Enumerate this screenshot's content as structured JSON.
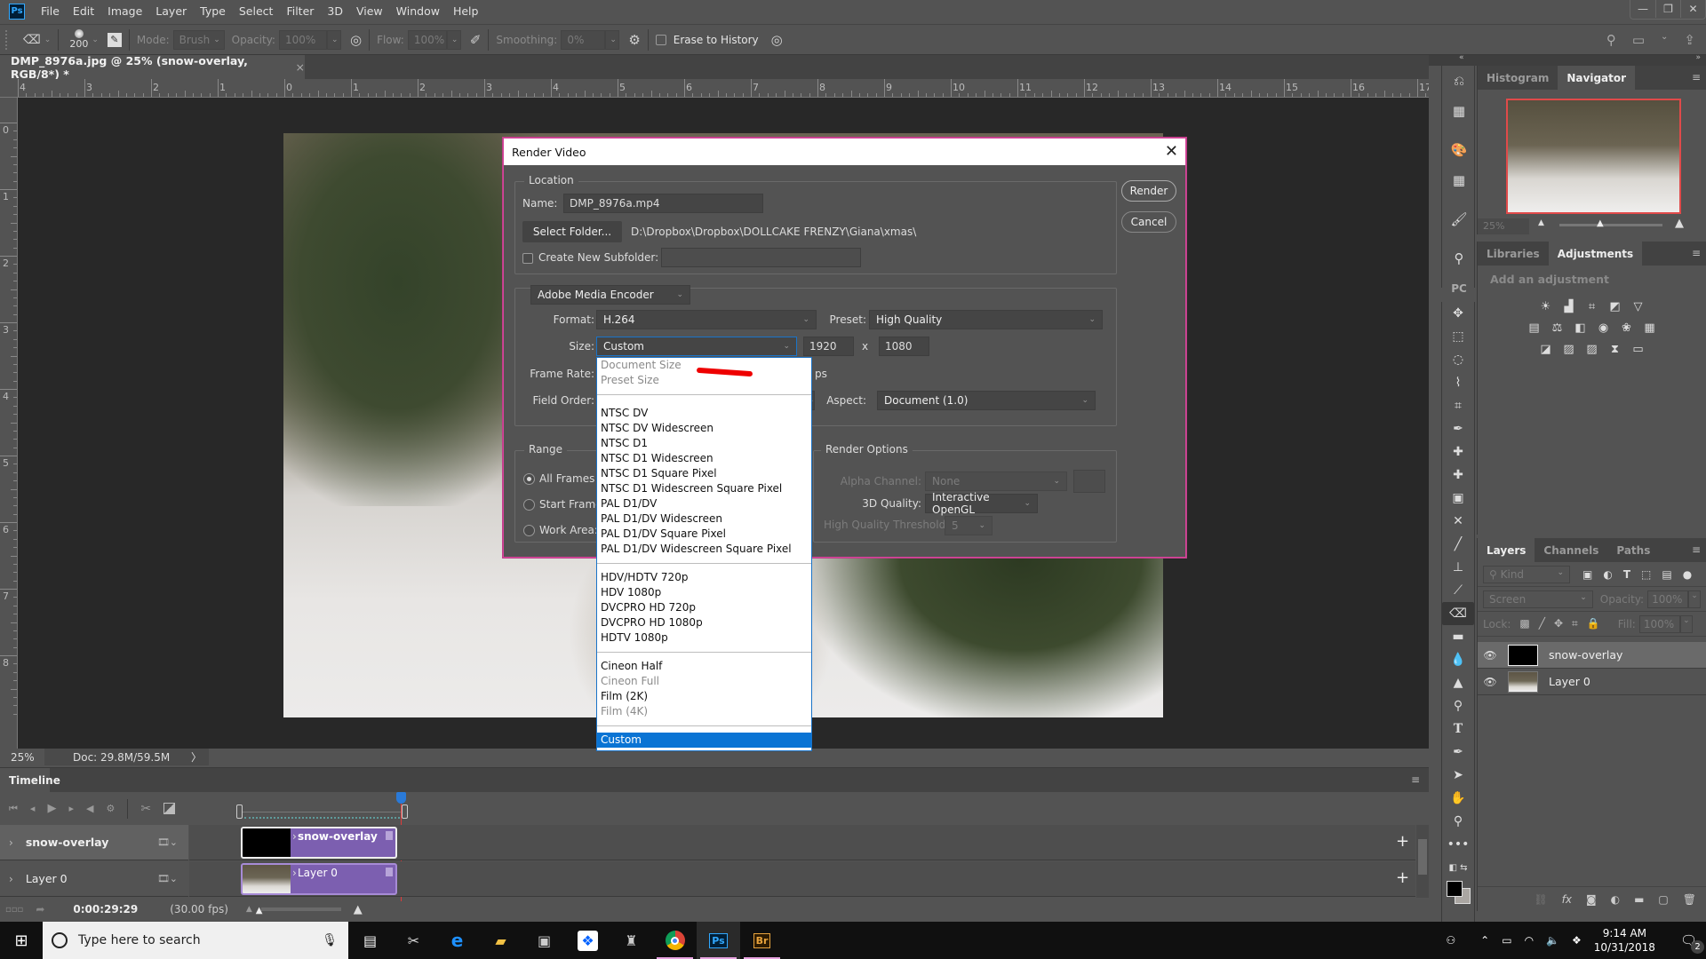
{
  "app": {
    "logo": "Ps"
  },
  "menu": [
    "File",
    "Edit",
    "Image",
    "Layer",
    "Type",
    "Select",
    "Filter",
    "3D",
    "View",
    "Window",
    "Help"
  ],
  "window_controls": {
    "minimize": "—",
    "restore": "❐",
    "close": "✕"
  },
  "options_bar": {
    "brush_size": "200",
    "mode_label": "Mode:",
    "mode_value": "Brush",
    "opacity_label": "Opacity:",
    "opacity_value": "100%",
    "flow_label": "Flow:",
    "flow_value": "100%",
    "smoothing_label": "Smoothing:",
    "smoothing_value": "0%",
    "erase_history_label": "Erase to History",
    "erase_history_checked": false
  },
  "document": {
    "tab_title": "DMP_8976a.jpg @ 25% (snow-overlay, RGB/8*) *",
    "close": "×",
    "ruler_top": [
      "4",
      "3",
      "2",
      "1",
      "0",
      "1",
      "2",
      "3",
      "4",
      "5",
      "6",
      "7",
      "8",
      "9",
      "10",
      "11",
      "12",
      "13",
      "14",
      "15",
      "16",
      "17"
    ],
    "ruler_left": [
      "0",
      "1",
      "2",
      "3",
      "4",
      "5",
      "6",
      "7",
      "8"
    ]
  },
  "status": {
    "zoom": "25%",
    "doc": "Doc: 29.8M/59.5M",
    "arrow": "〉"
  },
  "dialog": {
    "title": "Render Video",
    "close": "✕",
    "location_label": "Location",
    "name_label": "Name:",
    "name_value": "DMP_8976a.mp4",
    "select_folder": "Select Folder...",
    "folder_path": "D:\\Dropbox\\Dropbox\\DOLLCAKE FRENZY\\Giana\\xmas\\",
    "create_subfolder_label": "Create New Subfolder:",
    "create_subfolder_checked": false,
    "subfolder_value": "",
    "encoder": "Adobe Media Encoder",
    "format_label": "Format:",
    "format_value": "H.264",
    "preset_label": "Preset:",
    "preset_value": "High Quality",
    "size_label": "Size:",
    "size_value": "Custom",
    "width": "1920",
    "x_sep": "x",
    "height": "1080",
    "frame_rate_label": "Frame Rate:",
    "frame_rate_suffix": "ps",
    "field_order_label": "Field Order:",
    "aspect_label": "Aspect:",
    "aspect_value": "Document (1.0)",
    "range_label": "Range",
    "range_options": [
      {
        "label": "All Frames",
        "selected": true
      },
      {
        "label": "Start Frame",
        "selected": false
      },
      {
        "label": "Work Area:",
        "selected": false
      }
    ],
    "render_options_label": "Render Options",
    "alpha_label": "Alpha Channel:",
    "alpha_value": "None",
    "quality_label": "3D Quality:",
    "quality_value": "Interactive OpenGL",
    "threshold_label": "High Quality Threshold:",
    "threshold_value": "5",
    "render_button": "Render",
    "cancel_button": "Cancel"
  },
  "size_dropdown": {
    "groups": [
      [
        {
          "label": "Document Size",
          "disabled": true
        },
        {
          "label": "Preset Size",
          "disabled": true
        }
      ],
      [
        {
          "label": "NTSC DV"
        },
        {
          "label": "NTSC DV Widescreen"
        },
        {
          "label": "NTSC D1"
        },
        {
          "label": "NTSC D1 Widescreen"
        },
        {
          "label": "NTSC D1 Square Pixel"
        },
        {
          "label": "NTSC D1 Widescreen Square Pixel"
        },
        {
          "label": "PAL D1/DV"
        },
        {
          "label": "PAL D1/DV Widescreen"
        },
        {
          "label": "PAL D1/DV Square Pixel"
        },
        {
          "label": "PAL D1/DV Widescreen Square Pixel"
        }
      ],
      [
        {
          "label": "HDV/HDTV 720p"
        },
        {
          "label": "HDV 1080p"
        },
        {
          "label": "DVCPRO HD 720p"
        },
        {
          "label": "DVCPRO HD 1080p"
        },
        {
          "label": "HDTV 1080p"
        }
      ],
      [
        {
          "label": "Cineon Half"
        },
        {
          "label": "Cineon Full",
          "disabled": true
        },
        {
          "label": "Film (2K)"
        },
        {
          "label": "Film (4K)",
          "disabled": true
        }
      ],
      [
        {
          "label": "Custom",
          "selected": true
        }
      ]
    ]
  },
  "timeline": {
    "tab": "Timeline",
    "tracks": [
      {
        "name": "snow-overlay",
        "clip": "snow-overlay"
      },
      {
        "name": "Layer 0",
        "clip": "Layer 0"
      }
    ],
    "timecode": "0:00:29:29",
    "fps": "(30.00 fps)"
  },
  "panels": {
    "histogram_tab": "Histogram",
    "navigator_tab": "Navigator",
    "nav_zoom": "25%",
    "libraries_tab": "Libraries",
    "adjustments_tab": "Adjustments",
    "add_adjustment": "Add an adjustment",
    "layers_tab": "Layers",
    "channels_tab": "Channels",
    "paths_tab": "Paths",
    "kind_placeholder": "Kind",
    "blend_mode": "Screen",
    "opacity_label": "Opacity:",
    "opacity_value": "100%",
    "lock_label": "Lock:",
    "fill_label": "Fill:",
    "fill_value": "100%",
    "layers": [
      {
        "name": "snow-overlay",
        "selected": true,
        "visible": true
      },
      {
        "name": "Layer 0",
        "selected": false,
        "visible": true
      }
    ]
  },
  "taskbar": {
    "search_placeholder": "Type here to search",
    "time": "9:14 AM",
    "date": "10/31/2018",
    "notifications": "2"
  },
  "colors": {
    "accent": "#31a8ff",
    "clip": "#7c5fb0",
    "selection": "#0a74d4",
    "dialog_border": "#d6449a"
  }
}
